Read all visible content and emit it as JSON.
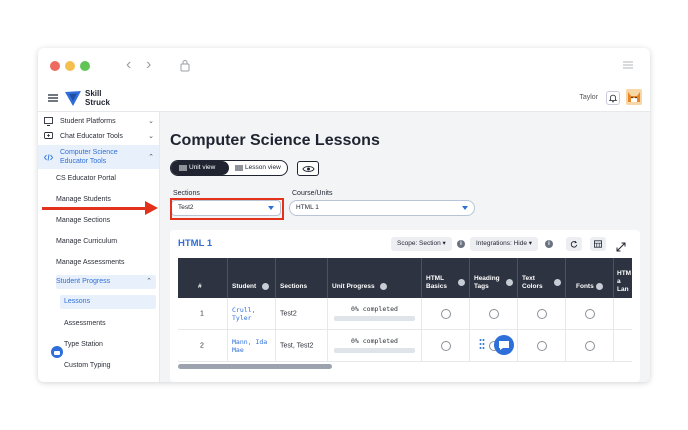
{
  "app": {
    "brand_line1": "Skill",
    "brand_line2": "Struck",
    "user_name": "Taylor"
  },
  "sidebar": {
    "items": [
      {
        "label": "Student Platforms"
      },
      {
        "label": "Chat Educator Tools"
      },
      {
        "label_line1": "Computer Science",
        "label_line2": "Educator Tools"
      }
    ],
    "sub_items": [
      "CS Educator Portal",
      "Manage Students",
      "Manage Sections",
      "Manage Curriculum",
      "Manage Assessments"
    ],
    "student_progress": "Student Progress",
    "progress_items": [
      "Lessons",
      "Assessments",
      "Type Station",
      "Custom Typing"
    ]
  },
  "main": {
    "title": "Computer Science Lessons",
    "toggle": {
      "unit_view": "Unit view",
      "lesson_view": "Lesson view"
    },
    "sections_label": "Sections",
    "sections_value": "Test2",
    "course_label": "Course/Units",
    "course_value": "HTML 1"
  },
  "card": {
    "title": "HTML 1",
    "scope_btn": "Scope: Section ▾",
    "integrations_btn": "Integrations: Hide ▾",
    "info_glyph": "i",
    "columns": [
      "#",
      "Student",
      "Sections",
      "Unit Progress",
      "HTML Basics",
      "Heading Tags",
      "Text Colors",
      "Fonts",
      "HTML a Lan"
    ],
    "columns_lines": {
      "html_basics": [
        "HTML",
        "Basics"
      ],
      "heading_tags": [
        "Heading",
        "Tags"
      ],
      "text_colors": [
        "Text",
        "Colors"
      ],
      "html_a_lan": [
        "HTM",
        "a",
        "Lan"
      ]
    },
    "rows": [
      {
        "num": "1",
        "student_line1": "Crull,",
        "student_line2": "Tyler",
        "sections": "Test2",
        "progress": "0% completed"
      },
      {
        "num": "2",
        "student_line1": "Mann, Ida",
        "student_line2": "Mae",
        "sections": "Test, Test2",
        "progress": "0% completed"
      }
    ]
  },
  "colors": {
    "accent": "#2e6fd9",
    "annotation": "#e3321c",
    "table_header": "#2d3340"
  }
}
